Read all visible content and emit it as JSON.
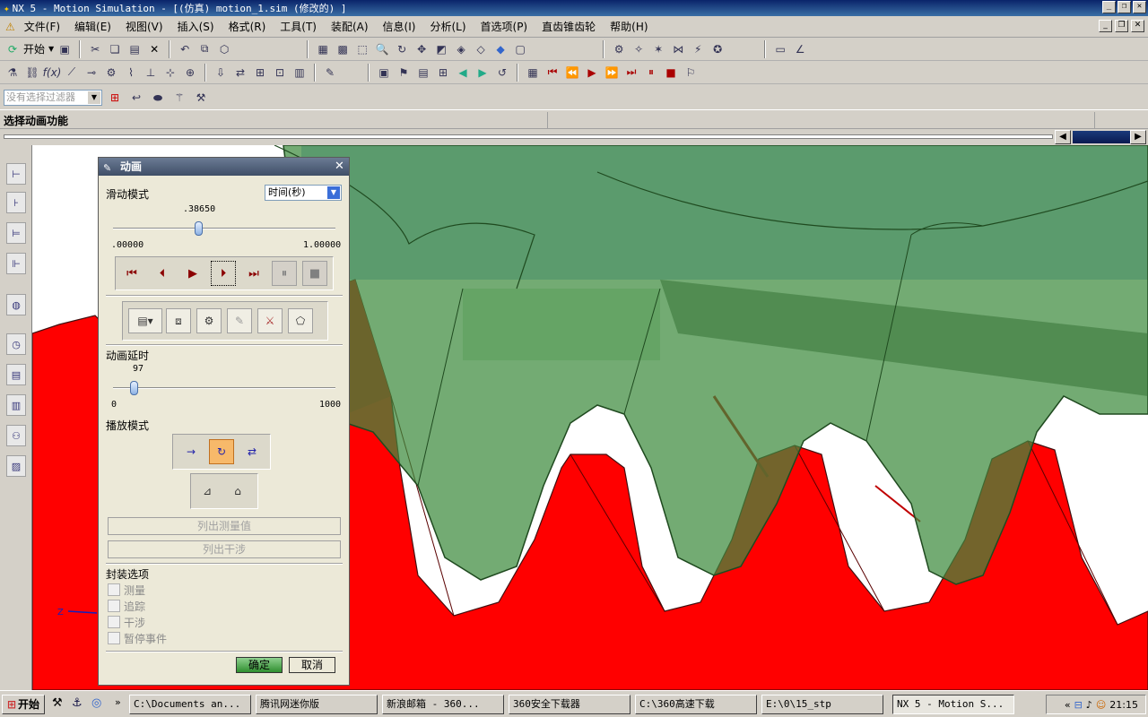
{
  "window": {
    "title": "NX 5 - Motion Simulation - [(仿真) motion_1.sim (修改的) ]"
  },
  "menu": [
    "文件(F)",
    "编辑(E)",
    "视图(V)",
    "插入(S)",
    "格式(R)",
    "工具(T)",
    "装配(A)",
    "信息(I)",
    "分析(L)",
    "首选项(P)",
    "直齿锥齿轮",
    "帮助(H)"
  ],
  "toolbar": {
    "start_label": "开始"
  },
  "filter": {
    "placeholder": "没有选择过滤器"
  },
  "cue": {
    "text": "选择动画功能"
  },
  "dialog": {
    "title": "动画",
    "slide_mode_label": "滑动模式",
    "slide_mode_value": "时间(秒)",
    "time_value": ".38650",
    "time_position": 0.3865,
    "time_min": ".00000",
    "time_max": "1.00000",
    "delay_label": "动画延时",
    "delay_value": "97",
    "delay_position": 0.097,
    "delay_min": "0",
    "delay_max": "1000",
    "playback_label": "播放模式",
    "list_measures": "列出测量值",
    "list_interference": "列出干涉",
    "package_label": "封装选项",
    "checkboxes": [
      "测量",
      "追踪",
      "干涉",
      "暂停事件"
    ],
    "ok": "确定",
    "cancel": "取消"
  },
  "taskbar": {
    "start": "开始",
    "tasks": [
      "C:\\Documents an...",
      "腾讯网迷你版",
      "新浪邮箱 - 360...",
      "360安全下载器",
      "C:\\360高速下载",
      "E:\\0\\15_stp",
      "NX 5 - Motion S..."
    ],
    "clock": "21:15"
  },
  "colors": {
    "gear_red": "#ff0000",
    "gear_green": "#3d8a3d",
    "titlebar": "#0a246a",
    "sky": "#a9c6e8"
  }
}
